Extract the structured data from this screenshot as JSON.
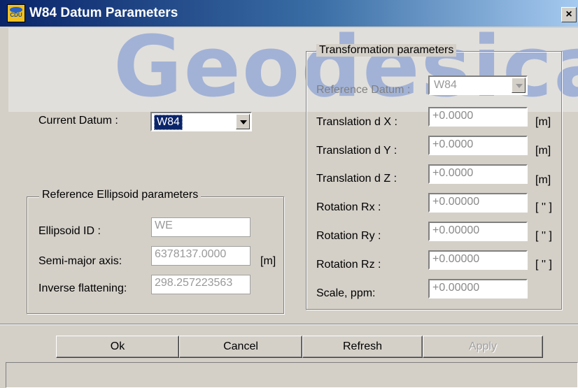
{
  "window": {
    "title": "W84 Datum Parameters",
    "icon_text": "CDU",
    "close_glyph": "×"
  },
  "watermark": "Geodesical",
  "current_datum": {
    "label": "Current Datum :",
    "value": "W84"
  },
  "ellipsoid": {
    "group_title": "Reference Ellipsoid parameters",
    "id_label": "Ellipsoid ID :",
    "id_value": "WE",
    "semi_major_label": "Semi-major axis:",
    "semi_major_value": "6378137.0000",
    "semi_major_unit": "[m]",
    "inv_flat_label": "Inverse flattening:",
    "inv_flat_value": "298.257223563"
  },
  "transformation": {
    "group_title": "Transformation parameters",
    "ref_datum_label": "Reference Datum :",
    "ref_datum_value": "W84",
    "rows": [
      {
        "label": "Translation d X :",
        "value": "+0.0000",
        "unit": "[m]"
      },
      {
        "label": "Translation d Y :",
        "value": "+0.0000",
        "unit": "[m]"
      },
      {
        "label": "Translation d Z :",
        "value": "+0.0000",
        "unit": "[m]"
      },
      {
        "label": "Rotation Rx :",
        "value": "+0.00000",
        "unit": "[ '' ]"
      },
      {
        "label": "Rotation Ry :",
        "value": "+0.00000",
        "unit": "[ '' ]"
      },
      {
        "label": "Rotation Rz :",
        "value": "+0.00000",
        "unit": "[ '' ]"
      },
      {
        "label": "Scale, ppm:",
        "value": "+0.00000",
        "unit": ""
      }
    ]
  },
  "buttons": {
    "ok": "Ok",
    "cancel": "Cancel",
    "refresh": "Refresh",
    "apply": "Apply"
  },
  "colors": {
    "title_bar": "#0a246a",
    "face": "#d4d0c8",
    "watermark": "#2d5fcd"
  }
}
